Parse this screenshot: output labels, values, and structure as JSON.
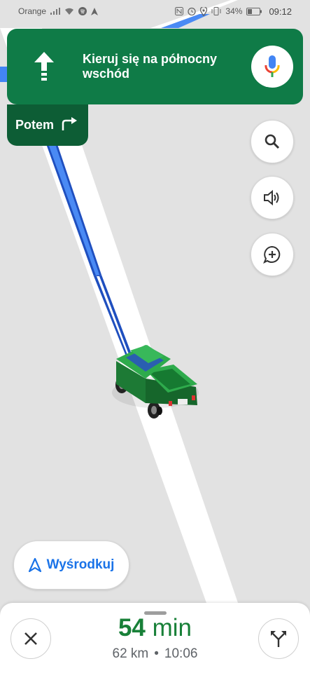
{
  "status_bar": {
    "carrier": "Orange",
    "battery": "34%",
    "time": "09:12"
  },
  "navigation": {
    "instruction": "Kieruj się na północny wschód",
    "then_label": "Potem"
  },
  "recenter": {
    "label": "Wyśrodkuj"
  },
  "trip": {
    "duration_value": "54",
    "duration_unit": "min",
    "distance": "62 km",
    "separator": "•",
    "arrival": "10:06"
  },
  "colors": {
    "nav_green": "#0f7b47",
    "nav_green_dark": "#0d5d35",
    "route_blue": "#4285f4",
    "eta_green": "#188038",
    "accent_blue": "#1a73e8"
  }
}
